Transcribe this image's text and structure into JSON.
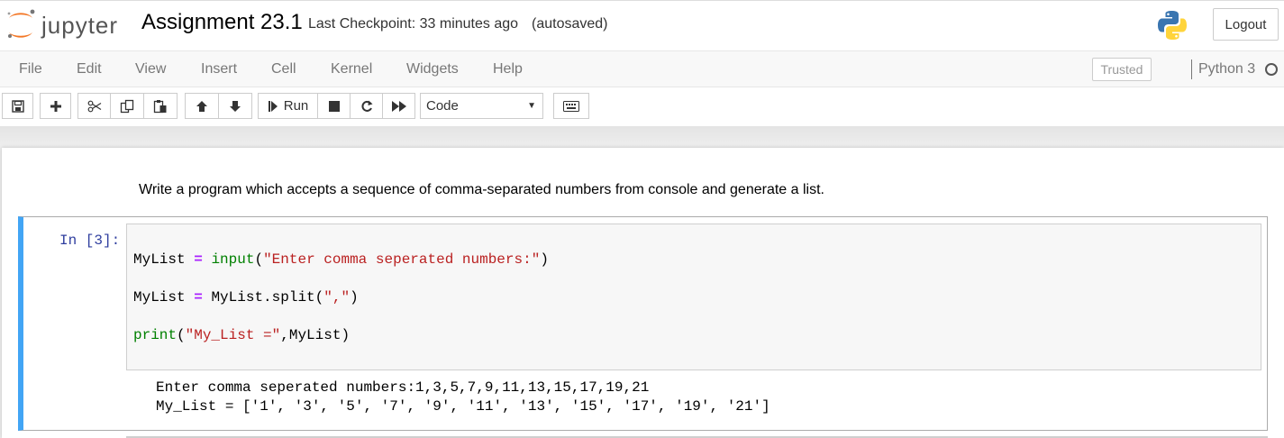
{
  "header": {
    "logo_text": "jupyter",
    "notebook_title": "Assignment 23.1",
    "checkpoint": "Last Checkpoint: 33 minutes ago",
    "autosave_status": "(autosaved)",
    "logout_label": "Logout"
  },
  "menubar": {
    "items": [
      "File",
      "Edit",
      "View",
      "Insert",
      "Cell",
      "Kernel",
      "Widgets",
      "Help"
    ],
    "trusted_label": "Trusted",
    "kernel_name": "Python 3"
  },
  "toolbar": {
    "run_label": "Run",
    "cell_type": "Code"
  },
  "cells": {
    "markdown_text": "Write a program which accepts a sequence of comma-separated numbers from console and generate a list.",
    "code": {
      "prompt": "In [3]:",
      "line1": {
        "var": "MyList",
        "op": "=",
        "func": "input",
        "open": "(",
        "str": "\"Enter comma seperated numbers:\"",
        "close": ")"
      },
      "line2": {
        "lhs": "MyList",
        "op": "=",
        "expr": "MyList.split(",
        "str": "\",\"",
        "close": ")"
      },
      "line3": {
        "func": "print",
        "open": "(",
        "str": "\"My_List =\"",
        "rest": ",MyList)"
      }
    },
    "output": {
      "line1": "Enter comma seperated numbers:1,3,5,7,9,11,13,15,17,19,21",
      "line2": "My_List = ['1', '3', '5', '7', '9', '11', '13', '15', '17', '19', '21']"
    }
  },
  "colors": {
    "accent_selected_cell": "#42a5f5",
    "prompt_color": "#303f9f",
    "jupyter_orange": "#f37726"
  }
}
